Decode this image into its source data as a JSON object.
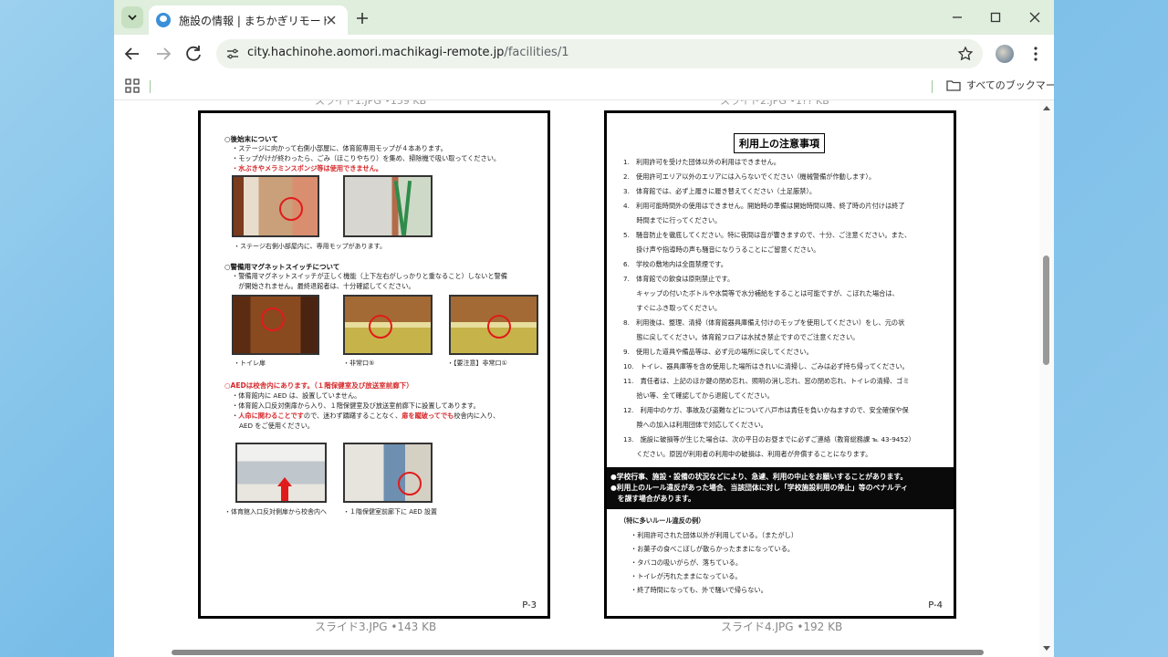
{
  "browser": {
    "tab_title": "施設の情報 | まちかぎリモート",
    "url_host": "city.hachinohe.aomori.machikagi-remote.jp",
    "url_path": "/facilities/1",
    "all_bookmarks": "すべてのブックマーク",
    "accent": "#dfeedd"
  },
  "gallery": {
    "top_captions": [
      "スライド1.JPG •159 KB",
      "スライド2.JPG •1?? KB"
    ],
    "left": {
      "caption": "スライド3.JPG •143 KB",
      "page_number": "P-3",
      "sec1_title": "○後始末について",
      "sec1_lines": [
        "・ステージに向かって右側小部屋に、体育館専用モップが４本あります。",
        "・モップがけが終わったら、ごみ（ほこりやちり）を集め、掃除機で吸い取ってください。"
      ],
      "sec1_warning": "・水ぶきやメラミンスポンジ等は使用できません。",
      "photo1_caption": "・ステージ右側小部屋内に、専用モップがあります。",
      "sec2_title": "○警備用マグネットスイッチについて",
      "sec2_lines": [
        "・警備用マグネットスイッチが正しく機能（上下左右がしっかりと重なること）しないと警備",
        "　が開始されません。最終退館者は、十分確認してください。"
      ],
      "photo_captions": [
        "・トイレ扉",
        "・非常口⑤",
        "・【要注意】非常口①"
      ],
      "sec3_title": "○AEDは校舎内にあります。（１階保健室及び放送室前廊下）",
      "sec3_lines": [
        "・体育館内に AED は、設置していません。",
        "・体育館入口反対側扉から入り、１階保健室及び放送室前廊下に設置してあります。"
      ],
      "sec3_red1": "人命に関わることです",
      "sec3_mid": "ので、迷わず躊躇することなく、",
      "sec3_red2": "扉を蹴破ってでも",
      "sec3_end": "校舎内に入り、",
      "sec3_last": "AED をご使用ください。",
      "bottom_captions": [
        "・体育館入口反対側扉から校舎内へ",
        "・１階保健室前廊下に AED 設置"
      ]
    },
    "right": {
      "caption": "スライド4.JPG •192 KB",
      "page_number": "P-4",
      "title": "利用上の注意事項",
      "rules": [
        "1.　利用許可を受けた団体以外の利用はできません。",
        "2.　使用許可エリア以外のエリアには入らないでください（機械警備が作動します）。",
        "3.　体育館では、必ず上履きに履き替えてください（土足厳禁）。",
        "4.　利用可能時間外の使用はできません。開始時の準備は開始時間以降、終了時の片付けは終了",
        "　　時間までに行ってください。",
        "5.　騒音防止を徹底してください。特に夜間は音が響きますので、十分、ご注意ください。また、",
        "　　掛け声や指導時の声も騒音になりうることにご留意ください。",
        "6.　学校の敷地内は全面禁煙です。",
        "7.　体育館での飲食は原則禁止です。",
        "　　キャップの付いたボトルや水筒等で水分補給をすることは可能ですが、こぼれた場合は、",
        "　　すぐにふき取ってください。",
        "8.　利用後は、整理、清掃（体育館器具庫備え付けのモップを使用してください）をし、元の状",
        "　　態に戻してください。体育館フロアは水拭き禁止ですのでご注意ください。",
        "9.　使用した道具や備品等は、必ず元の場所に戻してください。",
        "10.　トイレ、器具庫等を含め使用した場所はきれいに清掃し、ごみは必ず持ち帰ってください。",
        "11.　責任者は、上記のほか鍵の閉め忘れ、照明の消し忘れ、窓の閉め忘れ、トイレの清掃、ゴミ",
        "　　拾い等、全て確認してから退館してください。",
        "12.　利用中のケガ、事故及び盗難などについて八戸市は責任を負いかねますので、安全確保や保",
        "　　険への加入は利用団体で対応してください。",
        "13.　施設に破損等が生じた場合は、次の平日のお昼までに必ずご連絡（教育総務課 ℡ 43-9452）",
        "　　ください。原因が利用者の利用中の破損は、利用者が弁償することになります。"
      ],
      "band_lines": [
        "●学校行事、施設・設備の状況などにより、急遽、利用の中止をお願いすることがあります。",
        "●利用上のルール違反があった場合、当該団体に対し「学校施設利用の停止」等のペナルティ",
        "　を課す場合があります。"
      ],
      "violations_title": "（特に多いルール違反の例）",
      "violations": [
        "・利用許可された団体以外が利用している。（またがし）",
        "・お菓子の食べこぼしが散らかったままになっている。",
        "・タバコの吸いがらが、落ちている。",
        "・トイレが汚れたままになっている。",
        "・終了時間になっても、外で騒いで帰らない。"
      ]
    }
  }
}
